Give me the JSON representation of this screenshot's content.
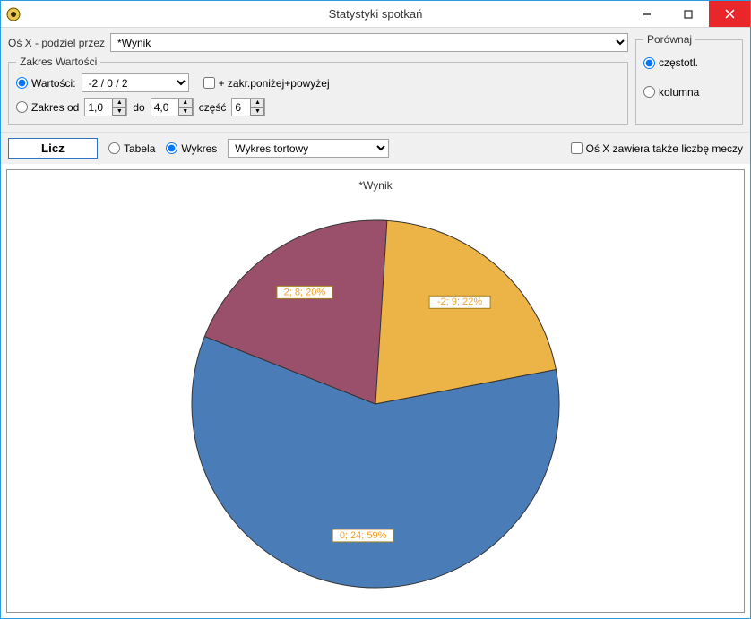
{
  "window": {
    "title": "Statystyki spotkań"
  },
  "config": {
    "axis_label": "Oś X - podziel przez",
    "axis_select": "*Wynik",
    "range_group": "Zakres Wartości",
    "values_radio": "Wartości:",
    "values_select": "-2 / 0 / 2",
    "extra_checkbox": "+ zakr.poniżej+powyżej",
    "range_from_radio": "Zakres od",
    "range_from": "1,0",
    "range_to_lbl": "do",
    "range_to": "4,0",
    "parts_lbl": "część",
    "parts": "6"
  },
  "compare": {
    "group": "Porównaj",
    "freq": "częstotl.",
    "column": "kolumna"
  },
  "toolbar": {
    "compute": "Licz",
    "table": "Tabela",
    "chart": "Wykres",
    "chart_type": "Wykres tortowy",
    "show_count": "Oś X zawiera także liczbę meczy"
  },
  "chart_data": {
    "type": "pie",
    "title": "*Wynik",
    "series": [
      {
        "category": "-2",
        "count": 9,
        "percent": 22,
        "label": "-2; 9; 22%",
        "color": "#ecb346"
      },
      {
        "category": "0",
        "count": 24,
        "percent": 59,
        "label": "0; 24; 59%",
        "color": "#4a7db7"
      },
      {
        "category": "2",
        "count": 8,
        "percent": 20,
        "label": "2; 8; 20%",
        "color": "#9a506b"
      }
    ]
  }
}
